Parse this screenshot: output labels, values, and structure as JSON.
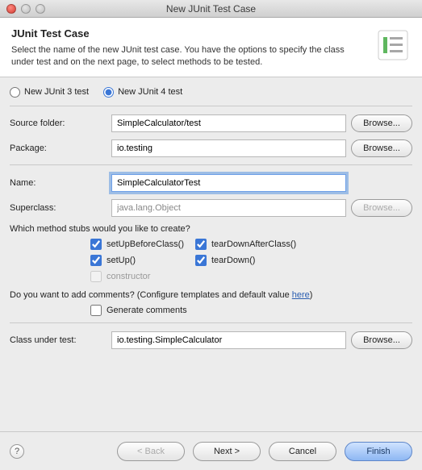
{
  "window": {
    "title": "New JUnit Test Case"
  },
  "header": {
    "title": "JUnit Test Case",
    "description": "Select the name of the new JUnit test case. You have the options to specify the class under test and on the next page, to select methods to be tested."
  },
  "radios": {
    "junit3": "New JUnit 3 test",
    "junit4": "New JUnit 4 test"
  },
  "fields": {
    "source_folder_label": "Source folder:",
    "source_folder_value": "SimpleCalculator/test",
    "package_label": "Package:",
    "package_value": "io.testing",
    "name_label": "Name:",
    "name_value": "SimpleCalculatorTest",
    "superclass_label": "Superclass:",
    "superclass_value": "java.lang.Object",
    "class_under_test_label": "Class under test:",
    "class_under_test_value": "io.testing.SimpleCalculator"
  },
  "stubs": {
    "question": "Which method stubs would you like to create?",
    "setUpBeforeClass": "setUpBeforeClass()",
    "tearDownAfterClass": "tearDownAfterClass()",
    "setUp": "setUp()",
    "tearDown": "tearDown()",
    "constructor": "constructor"
  },
  "comments": {
    "question_prefix": "Do you want to add comments? (Configure templates and default value ",
    "link": "here",
    "question_suffix": ")",
    "generate": "Generate comments"
  },
  "buttons": {
    "browse": "Browse...",
    "back": "< Back",
    "next": "Next >",
    "cancel": "Cancel",
    "finish": "Finish"
  }
}
